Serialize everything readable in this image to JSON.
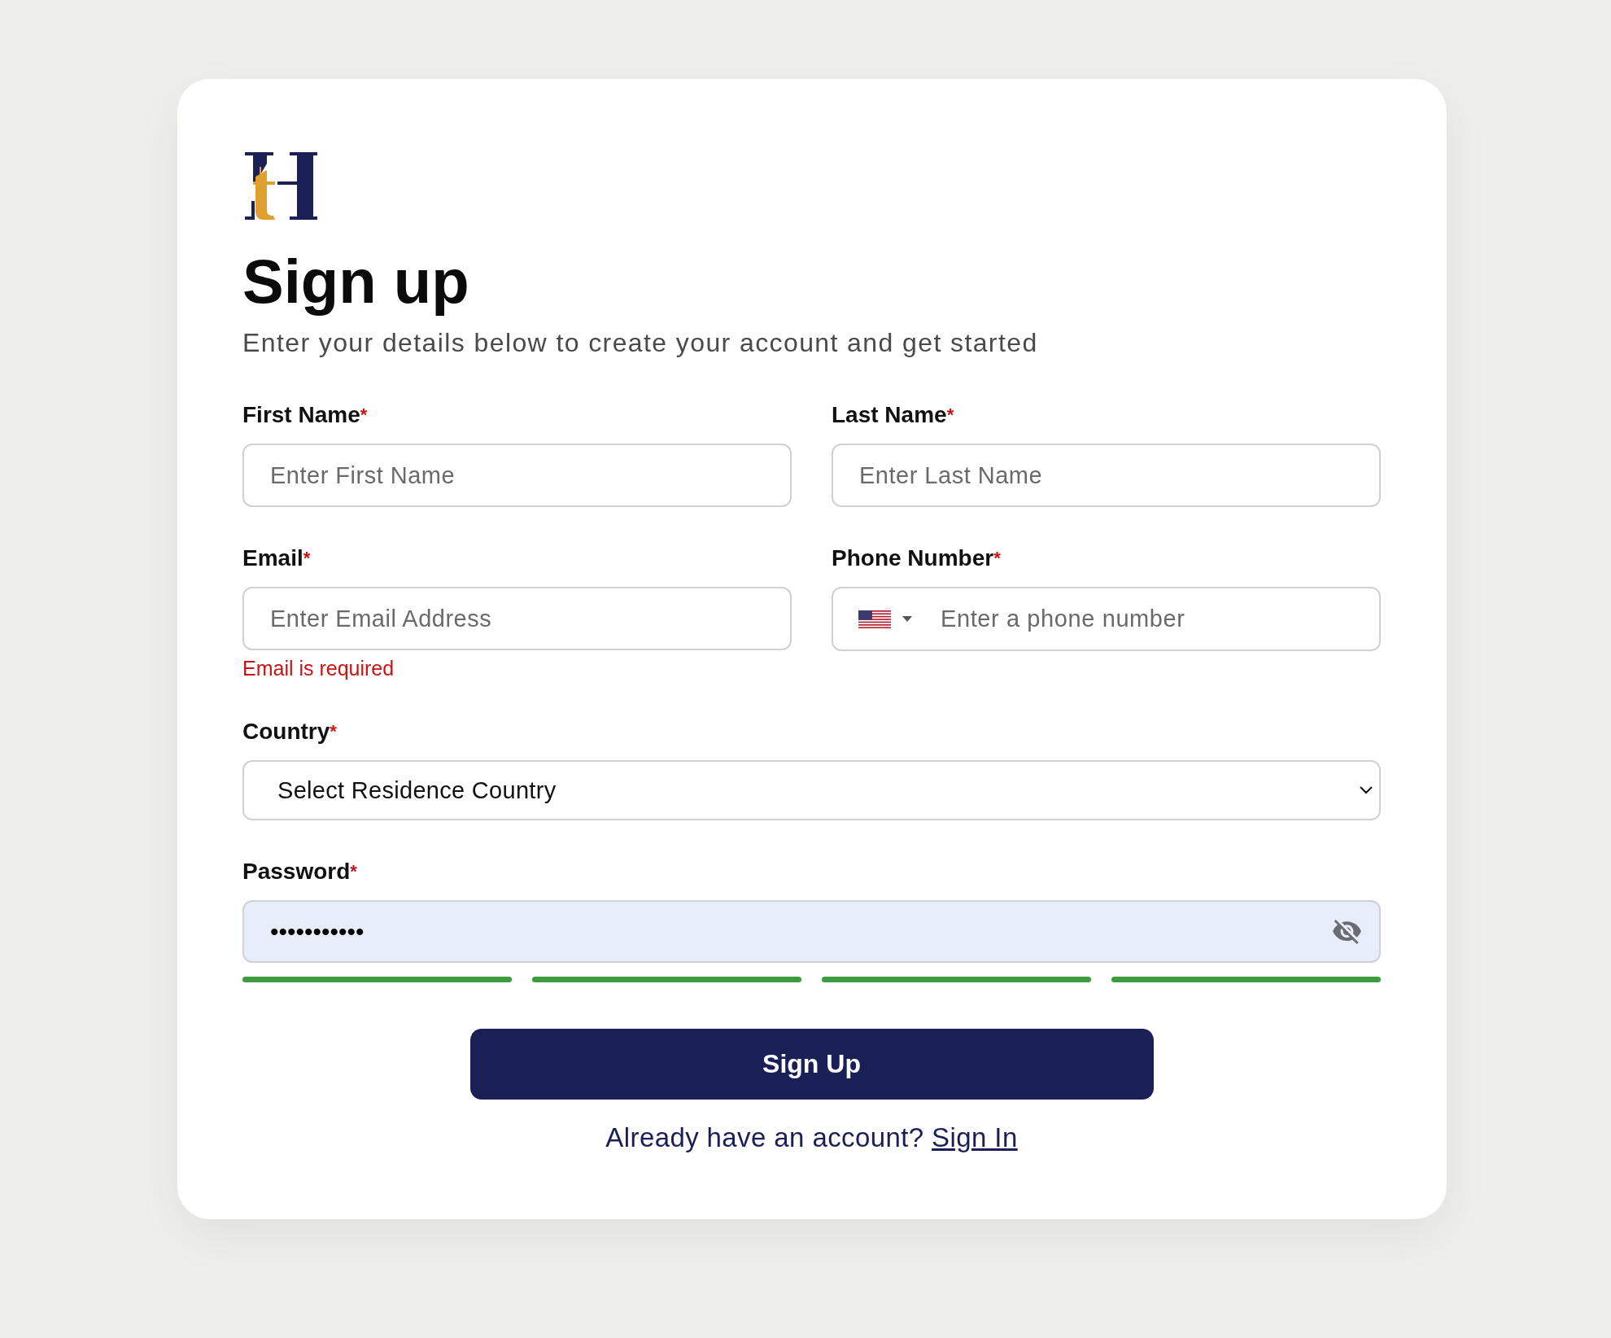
{
  "title": "Sign up",
  "subtitle": "Enter your details below to create your account and get started",
  "rows": [
    {
      "fields": [
        {
          "kind": "text",
          "label": "First Name",
          "required_mark": "*",
          "placeholder": "Enter First Name"
        },
        {
          "kind": "text",
          "label": "Last Name",
          "required_mark": "*",
          "placeholder": "Enter Last Name"
        }
      ]
    },
    {
      "fields": [
        {
          "kind": "text",
          "label": "Email",
          "required_mark": "*",
          "placeholder": "Enter Email Address",
          "error": "Email is required"
        },
        {
          "kind": "phone",
          "label": "Phone Number",
          "required_mark": "*",
          "placeholder": "Enter a phone number"
        }
      ]
    },
    {
      "fields": [
        {
          "kind": "select",
          "label": "Country",
          "required_mark": "*",
          "value": "Select Residence Country"
        }
      ]
    },
    {
      "fields": [
        {
          "kind": "password",
          "label": "Password",
          "required_mark": "*",
          "value": "•••••••••••",
          "autofilled": true,
          "strength": [
            {
              "on": true
            },
            {
              "on": true
            },
            {
              "on": true
            },
            {
              "on": true
            }
          ]
        }
      ]
    }
  ],
  "submit_button": "Sign Up",
  "footer": {
    "text": "Already have an account?",
    "link": "Sign In"
  }
}
